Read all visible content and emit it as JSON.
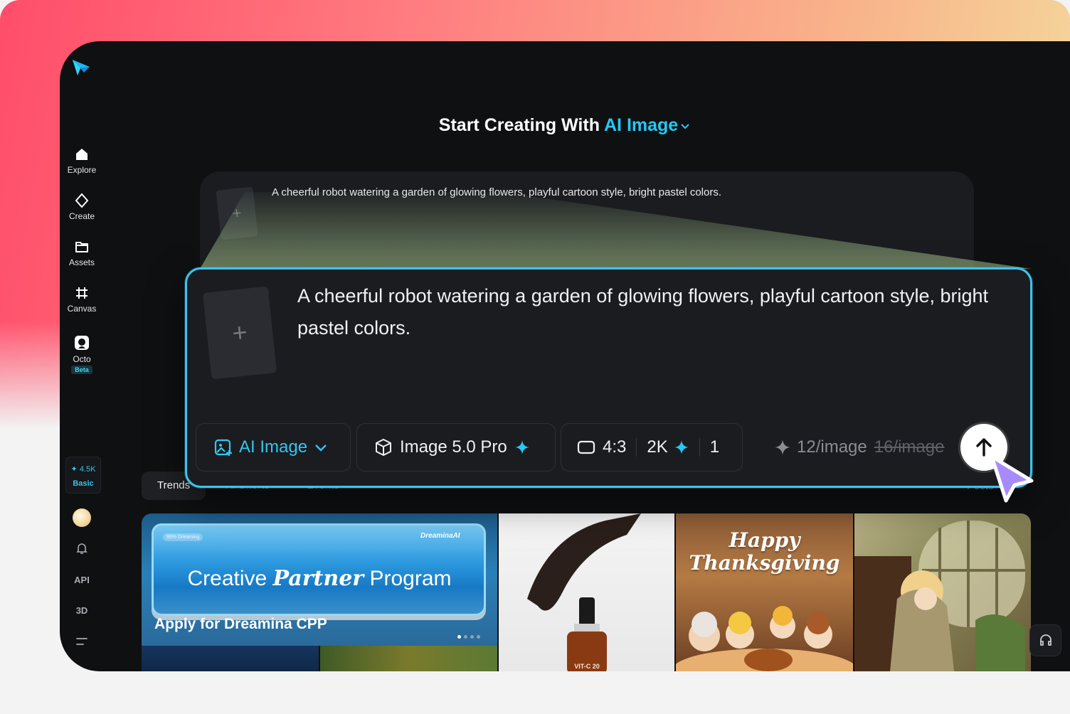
{
  "heading": {
    "prefix": "Start Creating With",
    "mode": "AI Image"
  },
  "prompt": {
    "text": "A cheerful robot watering a garden of glowing flowers, playful cartoon style, bright pastel colors.",
    "add_reference": "+"
  },
  "sidebar": {
    "items": [
      {
        "label": "Explore",
        "icon": "home-icon"
      },
      {
        "label": "Create",
        "icon": "sparkle-diamond-icon"
      },
      {
        "label": "Assets",
        "icon": "folder-icon"
      },
      {
        "label": "Canvas",
        "icon": "frame-grid-icon"
      },
      {
        "label": "Octo",
        "icon": "octo-icon",
        "badge": "Beta"
      }
    ],
    "credits": {
      "amount": "4.5K",
      "tier": "Basic"
    },
    "api_label": "API",
    "threed_label": "3D"
  },
  "toolbar": {
    "mode_label": "AI Image",
    "model_label": "Image 5.0 Pro",
    "ratio_label": "4:3",
    "resolution_label": "2K",
    "count_label": "1",
    "cost_label": "12/image",
    "old_cost_label": "16/image"
  },
  "tabs": {
    "active": "Trends",
    "items": [
      "Trends",
      "AI Shorts",
      "Events"
    ],
    "right": "Posts"
  },
  "gallery": {
    "banner": {
      "tag": "99% Dreaming",
      "brand": "DreaminaAI",
      "headline_start": "Creative",
      "headline_italic": "Partner",
      "headline_end": "Program",
      "caption": "Apply for Dreamina CPP"
    },
    "serum_label": "VIT-C 20",
    "thanks_line1": "Happy",
    "thanks_line2": "Thanksgiving"
  },
  "colors": {
    "accent": "#26c8f2",
    "app_bg": "#0f1012",
    "card_bg": "#1b1c20",
    "focus_border": "#3cc3ee",
    "cursor": "#a78bfa"
  }
}
